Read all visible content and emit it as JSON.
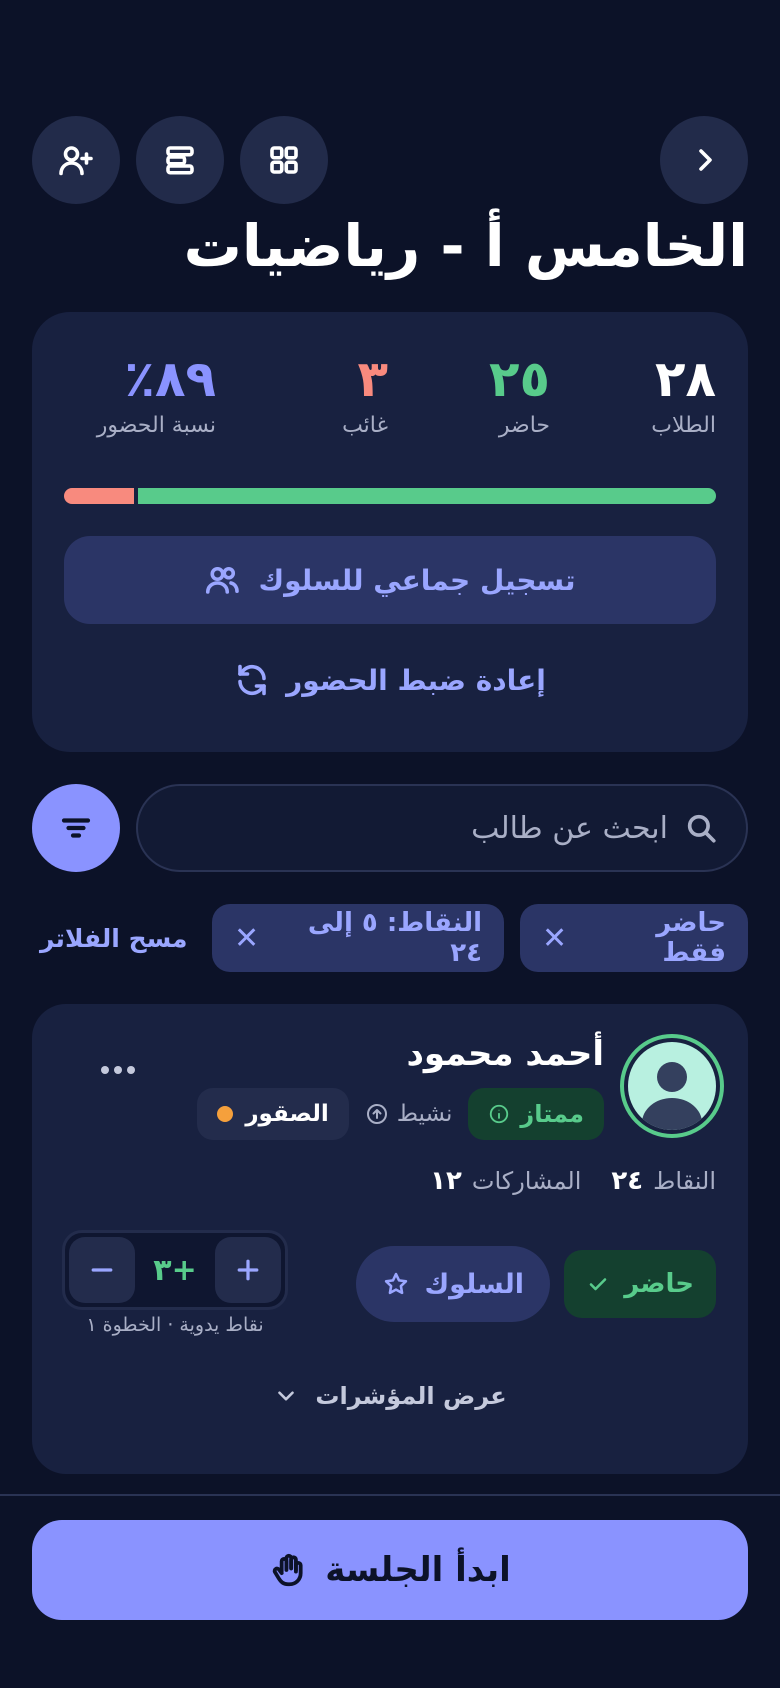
{
  "header": {
    "title": "الخامس أ - رياضيات",
    "back_icon": "chevron-right-icon",
    "grid_icon": "grid-icon",
    "list_icon": "list-icon",
    "add_user_icon": "user-plus-icon"
  },
  "stats": {
    "students": {
      "value": "٢٨",
      "label": "الطلاب",
      "color": "#ffffff"
    },
    "present": {
      "value": "٢٥",
      "label": "حاضر",
      "color": "#58cb8b"
    },
    "absent": {
      "value": "٣",
      "label": "غائب",
      "color": "#f88a7e"
    },
    "rate": {
      "value": "٨٩٪",
      "label": "نسبة الحضور",
      "color": "#8a93ff"
    },
    "absent_fraction": 0.107,
    "group_behavior_label": "تسجيل جماعي للسلوك",
    "reset_label": "إعادة ضبط الحضور"
  },
  "search": {
    "placeholder": "ابحث عن طالب",
    "value": ""
  },
  "filters": {
    "chips": [
      "حاضر فقط",
      "النقاط: ٥ إلى ٢٤"
    ],
    "clear_label": "مسح الفلاتر"
  },
  "student": {
    "name": "أحمد محمود",
    "level_badge": "ممتاز",
    "status": "نشيط",
    "team": "الصقور",
    "points_label": "النقاط",
    "points_value": "٢٤",
    "participations_label": "المشاركات",
    "participations_value": "١٢",
    "attendance_label": "حاضر",
    "behavior_label": "السلوك",
    "stepper_value": "+٣",
    "stepper_note": "نقاط يدوية · الخطوة ١",
    "indicators_label": "عرض المؤشرات"
  },
  "footer": {
    "start_label": "ابدأ الجلسة"
  },
  "colors": {
    "background": "#0c1228",
    "card": "#182140",
    "accent": "#8a93ff",
    "success": "#58cb8b",
    "danger": "#f88a7e",
    "warning": "#f5a03c"
  }
}
